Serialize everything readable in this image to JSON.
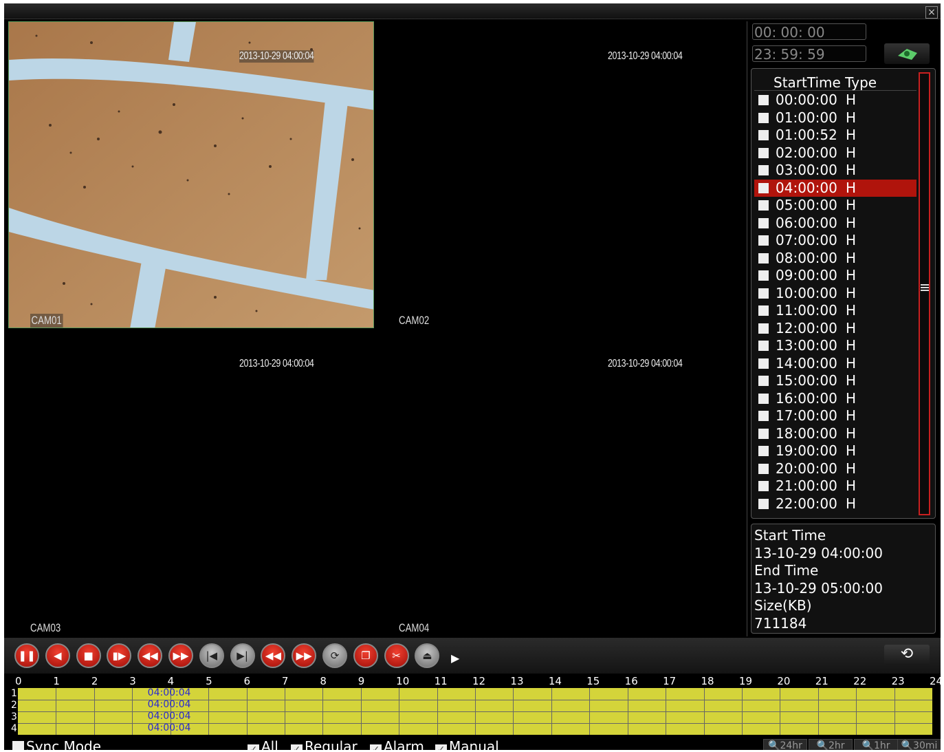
{
  "window": {
    "close_label": "×"
  },
  "cameras": [
    {
      "timestamp": "2013-10-29 04:00:04",
      "label": "CAM01"
    },
    {
      "timestamp": "2013-10-29 04:00:04",
      "label": "CAM02"
    },
    {
      "timestamp": "2013-10-29 04:00:04",
      "label": "CAM03"
    },
    {
      "timestamp": "2013-10-29 04:00:04",
      "label": "CAM04"
    }
  ],
  "search": {
    "start_time": "00: 00: 00",
    "end_time": "23: 59: 59",
    "button_icon": "search-icon"
  },
  "file_list": {
    "header": "StartTime Type",
    "rows": [
      {
        "time": "00:00:00",
        "type": "H"
      },
      {
        "time": "01:00:00",
        "type": "H"
      },
      {
        "time": "01:00:52",
        "type": "H"
      },
      {
        "time": "02:00:00",
        "type": "H"
      },
      {
        "time": "03:00:00",
        "type": "H"
      },
      {
        "time": "04:00:00",
        "type": "H",
        "selected": true
      },
      {
        "time": "05:00:00",
        "type": "H"
      },
      {
        "time": "06:00:00",
        "type": "H"
      },
      {
        "time": "07:00:00",
        "type": "H"
      },
      {
        "time": "08:00:00",
        "type": "H"
      },
      {
        "time": "09:00:00",
        "type": "H"
      },
      {
        "time": "10:00:00",
        "type": "H"
      },
      {
        "time": "11:00:00",
        "type": "H"
      },
      {
        "time": "12:00:00",
        "type": "H"
      },
      {
        "time": "13:00:00",
        "type": "H"
      },
      {
        "time": "14:00:00",
        "type": "H"
      },
      {
        "time": "15:00:00",
        "type": "H"
      },
      {
        "time": "16:00:00",
        "type": "H"
      },
      {
        "time": "17:00:00",
        "type": "H"
      },
      {
        "time": "18:00:00",
        "type": "H"
      },
      {
        "time": "19:00:00",
        "type": "H"
      },
      {
        "time": "20:00:00",
        "type": "H"
      },
      {
        "time": "21:00:00",
        "type": "H"
      },
      {
        "time": "22:00:00",
        "type": "H"
      }
    ],
    "selected_color": "#b0140c"
  },
  "file_info": {
    "start_label": "Start Time",
    "start_value": "13-10-29 04:00:00",
    "end_label": "End Time",
    "end_value": "13-10-29 05:00:00",
    "size_label": "Size(KB)",
    "size_value": "711184"
  },
  "controls": [
    {
      "name": "pause-button",
      "icon": "pause-icon",
      "glyph": "❚❚",
      "style": "red"
    },
    {
      "name": "reverse-play-button",
      "icon": "reverse-play-icon",
      "glyph": "◀",
      "style": "red"
    },
    {
      "name": "stop-button",
      "icon": "stop-icon",
      "glyph": "■",
      "style": "red"
    },
    {
      "name": "step-forward-button",
      "icon": "step-forward-icon",
      "glyph": "▮▶",
      "style": "red"
    },
    {
      "name": "rewind-button",
      "icon": "rewind-icon",
      "glyph": "◀◀",
      "style": "red"
    },
    {
      "name": "fast-forward-button",
      "icon": "fast-forward-icon",
      "glyph": "▶▶",
      "style": "red"
    },
    {
      "name": "previous-frame-button",
      "icon": "previous-frame-icon",
      "glyph": "|◀",
      "style": "gray"
    },
    {
      "name": "next-frame-button",
      "icon": "next-frame-icon",
      "glyph": "▶|",
      "style": "gray"
    },
    {
      "name": "previous-file-button",
      "icon": "previous-file-icon",
      "glyph": "◀◀",
      "style": "red"
    },
    {
      "name": "next-file-button",
      "icon": "next-file-icon",
      "glyph": "▶▶",
      "style": "red"
    },
    {
      "name": "loop-button",
      "icon": "loop-icon",
      "glyph": "⟳",
      "style": "gray"
    },
    {
      "name": "window-mode-button",
      "icon": "window-mode-icon",
      "glyph": "❐",
      "style": "red"
    },
    {
      "name": "clip-button",
      "icon": "scissors-icon",
      "glyph": "✂",
      "style": "red"
    },
    {
      "name": "backup-button",
      "icon": "backup-icon",
      "glyph": "⏏",
      "style": "gray"
    }
  ],
  "more_controls_icon": "play-arrow-icon",
  "sync_icon": "sync-icon",
  "timeline": {
    "hours": [
      "0",
      "1",
      "2",
      "3",
      "4",
      "5",
      "6",
      "7",
      "8",
      "9",
      "10",
      "11",
      "12",
      "13",
      "14",
      "15",
      "16",
      "17",
      "18",
      "19",
      "20",
      "21",
      "22",
      "23",
      "24"
    ],
    "channels": [
      {
        "num": "1",
        "time": "04:00:04"
      },
      {
        "num": "2",
        "time": "04:00:04"
      },
      {
        "num": "3",
        "time": "04:00:04"
      },
      {
        "num": "4",
        "time": "04:00:04"
      }
    ],
    "fill_color": "#d4d43a"
  },
  "filters": {
    "sync_mode": {
      "label": "Sync Mode",
      "checked": false
    },
    "all": {
      "label": "All",
      "checked": true
    },
    "regular": {
      "label": "Regular",
      "checked": true
    },
    "alarm": {
      "label": "Alarm",
      "checked": true
    },
    "manual": {
      "label": "Manual",
      "checked": true
    }
  },
  "zoom": [
    "24hr",
    "2hr",
    "1hr",
    "30mi"
  ]
}
